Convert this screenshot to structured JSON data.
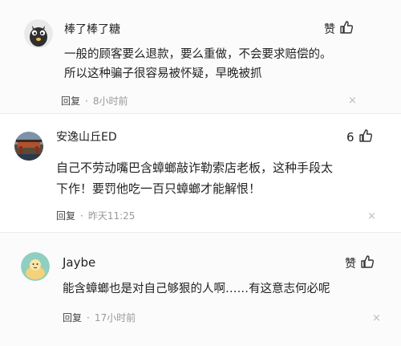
{
  "comments": [
    {
      "username": "棒了棒了糖",
      "like_label": "赞",
      "text_lines": [
        "一般的顾客要么退款，要么重做，不会要求赔偿的。",
        "所以这种骗子很容易被怀疑，早晚被抓"
      ],
      "reply_label": "回复",
      "separator": "·",
      "time": "8小时前",
      "close_glyph": "×"
    },
    {
      "username": "安逸山丘ED",
      "like_label": "6",
      "text_lines": [
        "自己不劳动嘴巴含蟑螂敲诈勒索店老板，这种手段太",
        "下作！要罚他吃一百只蟑螂才能解恨！"
      ],
      "reply_label": "回复",
      "separator": "·",
      "time": "昨天11:25",
      "close_glyph": "×"
    },
    {
      "username": "Jaybe",
      "like_label": "赞",
      "text_lines": [
        "能含蟑螂也是对自己够狠的人啊……有这意志何必呢"
      ],
      "reply_label": "回复",
      "separator": "·",
      "time": "17小时前",
      "close_glyph": "×"
    }
  ],
  "colors": {
    "text": "#222222",
    "muted": "#999999",
    "divider": "#ececec"
  }
}
